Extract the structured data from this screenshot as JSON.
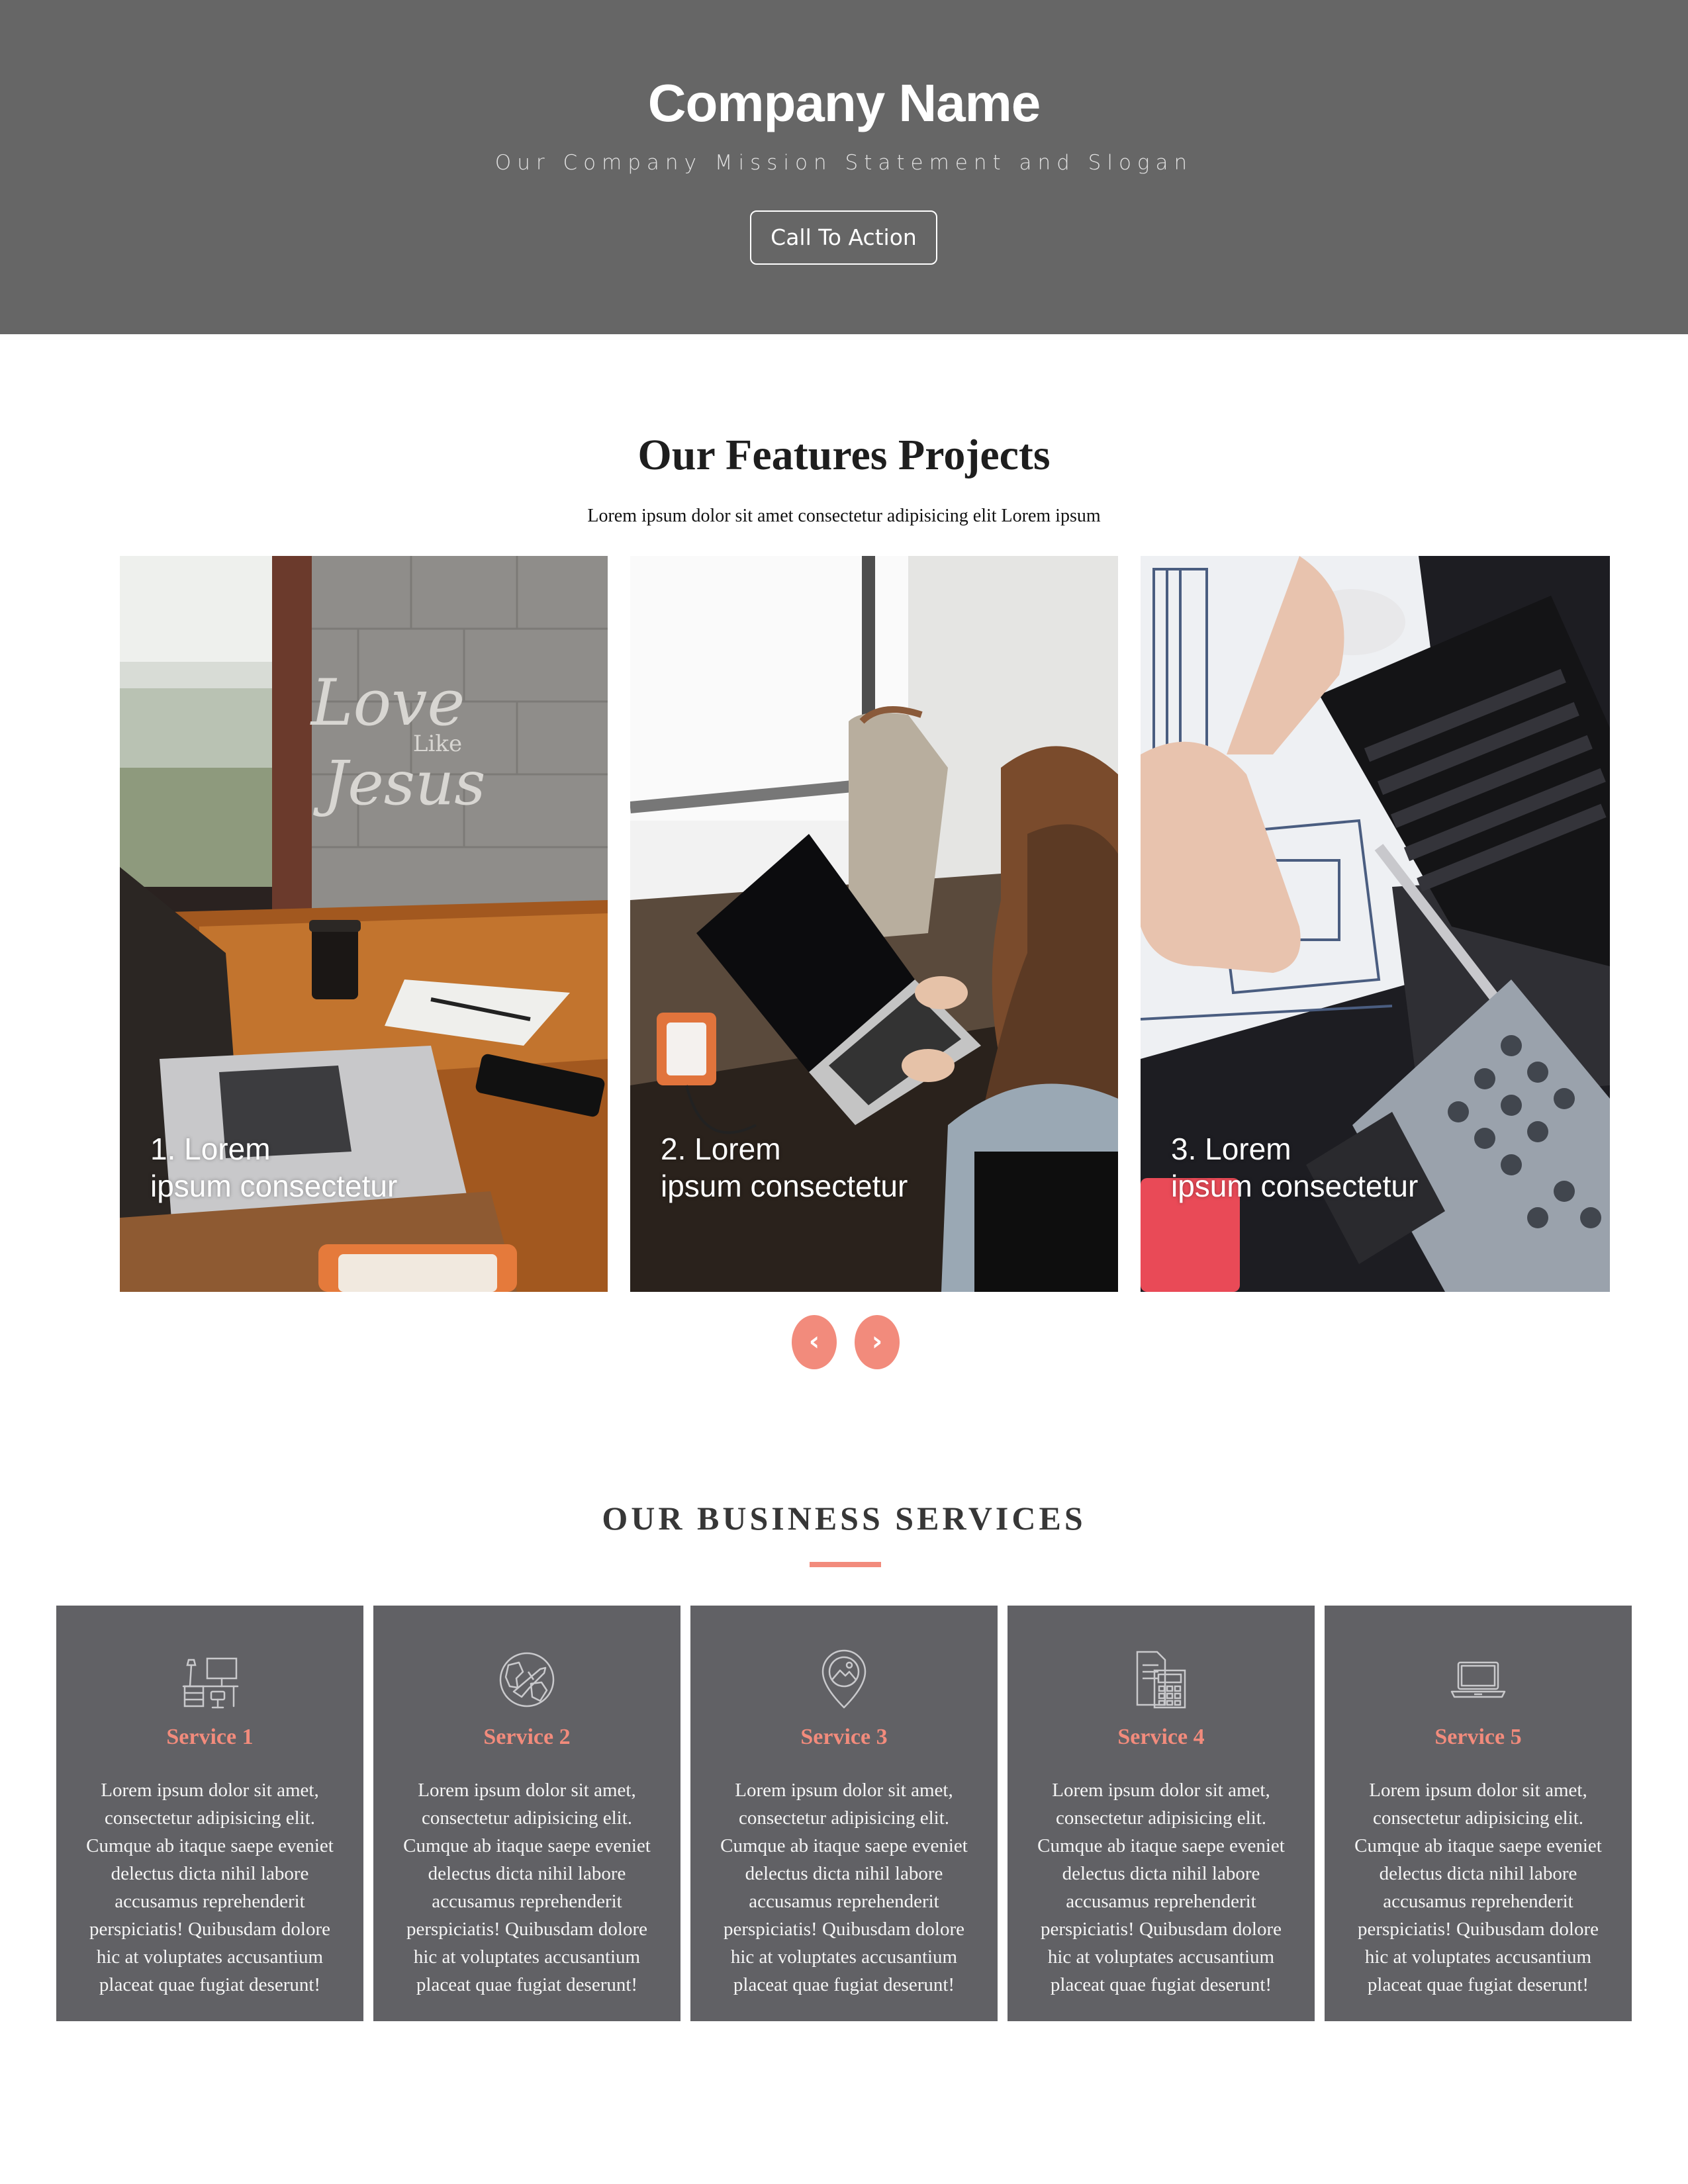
{
  "hero": {
    "title": "Company Name",
    "slogan": "Our Company Mission Statement and Slogan",
    "cta_label": "Call To Action",
    "background": "#666666"
  },
  "features": {
    "title": "Our Features Projects",
    "subtitle": "Lorem ipsum dolor sit amet consectetur adipisicing elit Lorem ipsum",
    "cards": [
      {
        "line1": "1. Lorem",
        "line2": "ipsum consectetur",
        "image_text": [
          "Love",
          "Like",
          "Jesus"
        ]
      },
      {
        "line1": "2. Lorem",
        "line2": "ipsum consectetur"
      },
      {
        "line1": "3. Lorem",
        "line2": "ipsum consectetur"
      }
    ],
    "prev_icon": "‹",
    "next_icon": "›",
    "accent": "#f28b7c"
  },
  "services": {
    "title": "OUR BUSINESS SERVICES",
    "card_background": "#616165",
    "items": [
      {
        "icon": "desk-icon",
        "title": "Service 1",
        "text": "Lorem ipsum dolor sit amet, consectetur adipisicing elit. Cumque ab itaque saepe eveniet delectus dicta nihil labore accusamus reprehenderit perspiciatis! Quibusdam dolore hic at voluptates accusantium placeat quae fugiat deserunt!"
      },
      {
        "icon": "globe-plane-icon",
        "title": "Service 2",
        "text": "Lorem ipsum dolor sit amet, consectetur adipisicing elit. Cumque ab itaque saepe eveniet delectus dicta nihil labore accusamus reprehenderit perspiciatis! Quibusdam dolore hic at voluptates accusantium placeat quae fugiat deserunt!"
      },
      {
        "icon": "map-pin-icon",
        "title": "Service 3",
        "text": "Lorem ipsum dolor sit amet, consectetur adipisicing elit. Cumque ab itaque saepe eveniet delectus dicta nihil labore accusamus reprehenderit perspiciatis! Quibusdam dolore hic at voluptates accusantium placeat quae fugiat deserunt!"
      },
      {
        "icon": "calculator-document-icon",
        "title": "Service 4",
        "text": "Lorem ipsum dolor sit amet, consectetur adipisicing elit. Cumque ab itaque saepe eveniet delectus dicta nihil labore accusamus reprehenderit perspiciatis! Quibusdam dolore hic at voluptates accusantium placeat quae fugiat deserunt!"
      },
      {
        "icon": "laptop-icon",
        "title": "Service 5",
        "text": "Lorem ipsum dolor sit amet, consectetur adipisicing elit. Cumque ab itaque saepe eveniet delectus dicta nihil labore accusamus reprehenderit perspiciatis! Quibusdam dolore hic at voluptates accusantium placeat quae fugiat deserunt!"
      }
    ]
  }
}
